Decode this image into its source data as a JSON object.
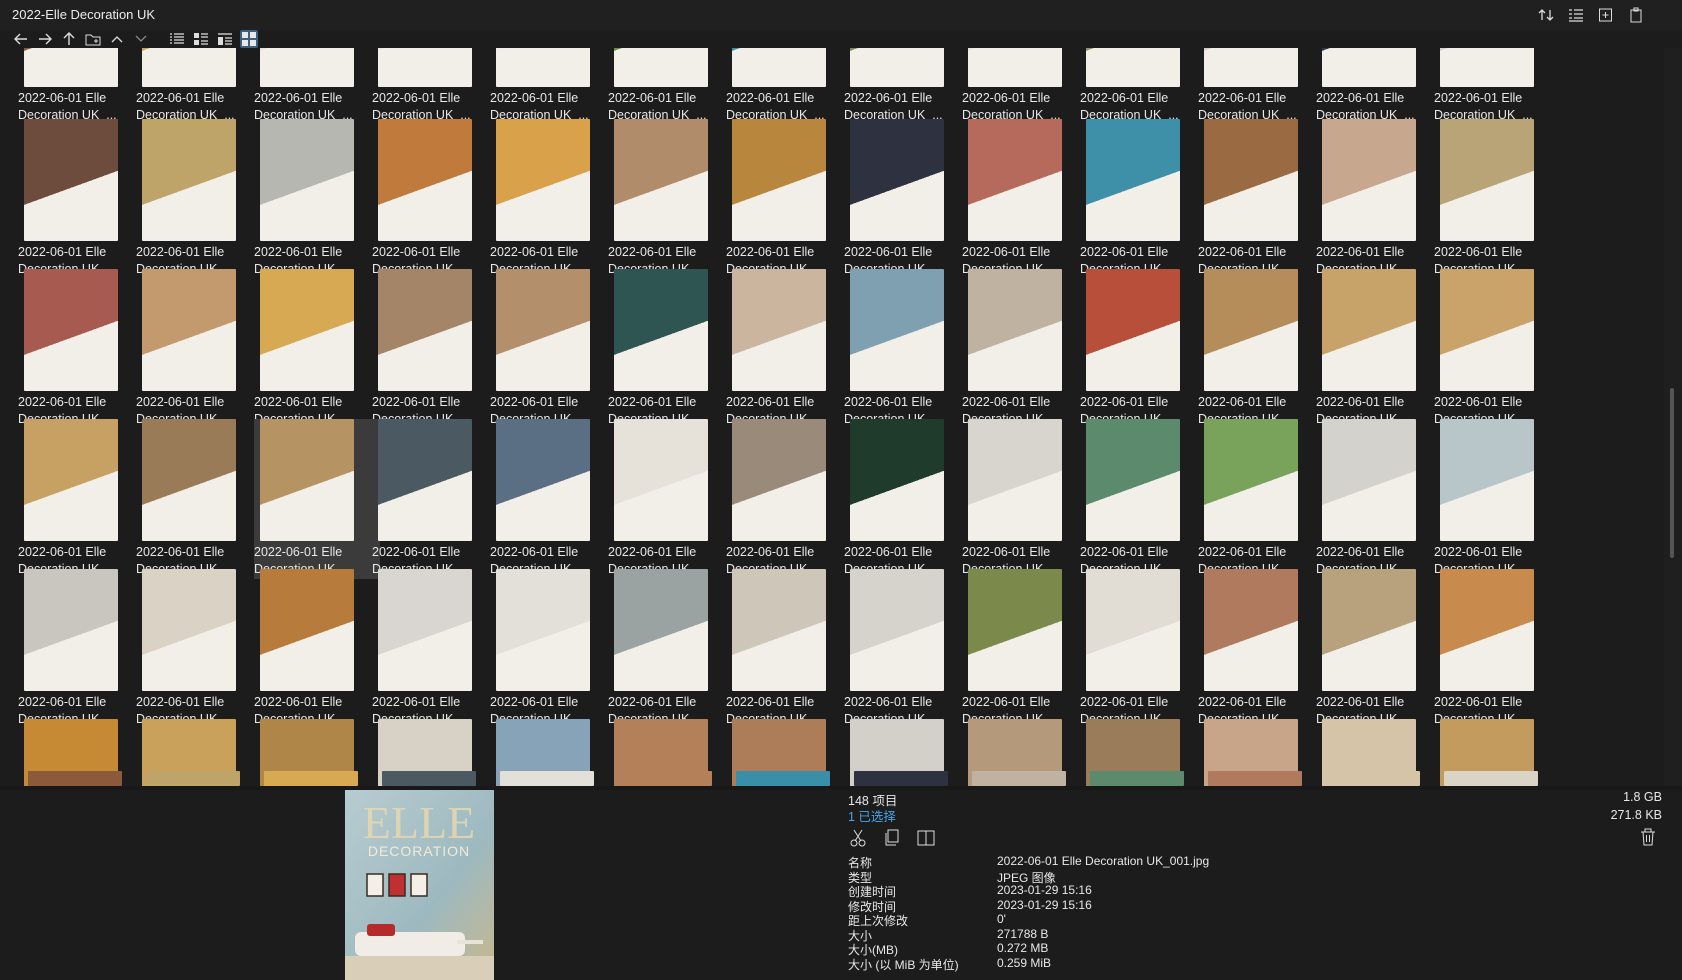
{
  "window": {
    "title": "2022-Elle Decoration UK"
  },
  "toolbar": {
    "nav": [
      {
        "name": "back-arrow-icon"
      },
      {
        "name": "forward-arrow-icon"
      },
      {
        "name": "up-arrow-icon"
      },
      {
        "name": "folder-icon"
      }
    ],
    "views": [
      {
        "name": "view-list-icon",
        "active": false
      },
      {
        "name": "view-details-icon",
        "active": false
      },
      {
        "name": "view-tiles-icon",
        "active": false
      },
      {
        "name": "view-thumbnails-icon",
        "active": true
      }
    ],
    "right_icons": [
      "sort-icon",
      "detail-pane-icon",
      "new-window-icon",
      "clipboard-icon"
    ]
  },
  "grid": {
    "caption_line1": "2022-06-01 Elle",
    "caption_line2": "Decoration UK_...",
    "selected_index": 41,
    "rows": [
      [
        "#8a5a3a",
        "#c9a25c",
        "#e8e4dc",
        "#ece9e2",
        "#efeeeb",
        "#6b8c4a",
        "#3a8fa8",
        "#7a8c5c",
        "#e9e6df",
        "#8a9572",
        "#d8cfc0",
        "#2e3a48",
        "#d9d4c6"
      ],
      [
        "#6d4c3d",
        "#bfa46a",
        "#b7b7b2",
        "#c07a3c",
        "#d9a24a",
        "#b08c6a",
        "#b8863c",
        "#2e3140",
        "#b56a5c",
        "#3e8fa8",
        "#9a6b42",
        "#c7a88f",
        "#b9a478"
      ],
      [
        "#a75a4f",
        "#c29a6d",
        "#d7a953",
        "#a58567",
        "#b48f6c",
        "#2e5552",
        "#cbb59f",
        "#7ea0b0",
        "#bfb2a1",
        "#b74f3b",
        "#b58d5a",
        "#c7a36a",
        "#c9a36a"
      ],
      [
        "#c7a064",
        "#9a7b57",
        "#b59363",
        "#4b5a62",
        "#5a6e84",
        "#e6e2da",
        "#9a8a7a",
        "#1f3b2c",
        "#d8d5ce",
        "#5c8a6c",
        "#79a25a",
        "#d4d2cc",
        "#b9c6c9"
      ],
      [
        "#c9c6c0",
        "#d9d2c5",
        "#b77b3c",
        "#d9d6d1",
        "#e3e0d9",
        "#9aa2a2",
        "#cdc6b9",
        "#d6d3cc",
        "#7b8a4a",
        "#e2ddd4",
        "#b07a5e",
        "#b8a27e",
        "#c98a4e"
      ],
      [
        "#c78a34",
        "#c9a15a",
        "#b08548",
        "#d8d2c6",
        "#86a3b8",
        "#b4805a",
        "#ad7d5a",
        "#d3d0c9",
        "#b49a7a",
        "#9b7c5a",
        "#c8a588",
        "#d6c4a8",
        "#c49b5f"
      ]
    ]
  },
  "detail": {
    "item_count": "148 项目",
    "selected_count": "1 已选择",
    "total_size": "1.8 GB",
    "selected_size": "271.8 KB",
    "actions": [
      "cut-icon",
      "copy-icon",
      "open-icon"
    ],
    "properties": [
      {
        "key": "名称",
        "value": "2022-06-01 Elle Decoration UK_001.jpg"
      },
      {
        "key": "类型",
        "value": "JPEG 图像"
      },
      {
        "key": "创建时间",
        "value": "2023-01-29  15:16"
      },
      {
        "key": "修改时间",
        "value": "2023-01-29  15:16"
      },
      {
        "key": "距上次修改",
        "value": "0'"
      },
      {
        "key": "大小",
        "value": "271788 B"
      },
      {
        "key": "大小(MB)",
        "value": "0.272 MB"
      },
      {
        "key": "大小 (以 MiB 为单位)",
        "value": "0.259 MiB"
      }
    ],
    "cover": {
      "masthead": "ELLE",
      "subtitle": "DECORATION",
      "bg": "#9fbcc4"
    }
  }
}
